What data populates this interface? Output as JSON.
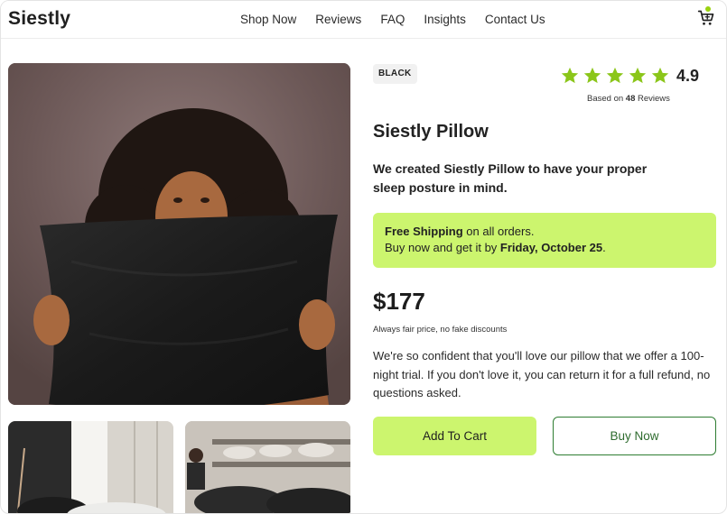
{
  "brand": {
    "name": "Siestly"
  },
  "nav": {
    "items": [
      {
        "label": "Shop Now"
      },
      {
        "label": "Reviews"
      },
      {
        "label": "FAQ"
      },
      {
        "label": "Insights"
      },
      {
        "label": "Contact Us"
      }
    ],
    "cart_icon": "shopping-cart-icon"
  },
  "product": {
    "color_badge": "BLACK",
    "rating": "4.9",
    "stars": 5,
    "reviews_prefix": "Based on",
    "reviews_count": "48",
    "reviews_suffix": "Reviews",
    "name": "Siestly Pillow",
    "tagline": "We created Siestly Pillow to have your proper sleep posture in mind.",
    "shipping_bold": "Free Shipping",
    "shipping_rest": " on all orders.",
    "delivery_prefix": "Buy now and get it by ",
    "delivery_date": "Friday, October 25",
    "delivery_suffix": ".",
    "price": "$177",
    "price_note": "Always fair price, no fake discounts",
    "description": "We're so confident that you'll love our pillow that we offer a 100-night trial. If you don't love it, you can return it for a full refund, no questions asked."
  },
  "actions": {
    "add_to_cart": "Add To Cart",
    "buy_now": "Buy Now"
  },
  "colors": {
    "accent": "#ccf56e",
    "star": "#8bc61a",
    "buy_border": "#2e7d32"
  }
}
